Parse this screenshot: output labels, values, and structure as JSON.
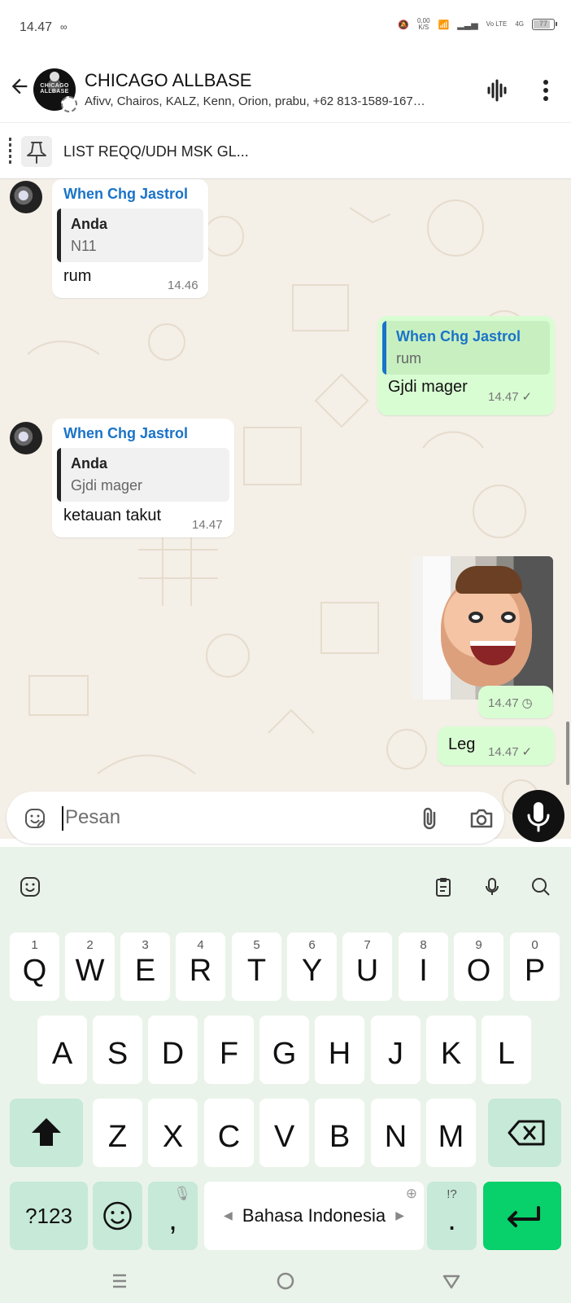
{
  "status_bar": {
    "time": "14.47",
    "speed_value": "0,00",
    "speed_unit": "K/S",
    "volte": "Vo LTE",
    "network": "4G",
    "battery": "77",
    "battery_level": 0.77
  },
  "header": {
    "title": "CHICAGO ALLBASE",
    "subtitle": "Afivv, Chairos, KALZ, Kenn, Orion, prabu, +62 813-1589-167…",
    "avatar_text": "CHICAGO ALLBASE"
  },
  "pinned": {
    "text": "LIST REQQ/UDH MSK GL..."
  },
  "messages": [
    {
      "sender": "When Chg Jastrol",
      "quote_author": "Anda",
      "quote_text": "N11",
      "text": "rum",
      "time": "14.46"
    },
    {
      "quote_author": "When Chg Jastrol",
      "quote_text": "rum",
      "text": "Gjdi mager",
      "time": "14.47"
    },
    {
      "sender": "When Chg Jastrol",
      "quote_author": "Anda",
      "quote_text": "Gjdi mager",
      "text": "ketauan takut",
      "time": "14.47"
    },
    {
      "time": "14.47"
    },
    {
      "text": "Leg",
      "time": "14.47"
    }
  ],
  "input": {
    "placeholder": "Pesan"
  },
  "keyboard": {
    "row1": [
      {
        "key": "Q",
        "num": "1"
      },
      {
        "key": "W",
        "num": "2"
      },
      {
        "key": "E",
        "num": "3"
      },
      {
        "key": "R",
        "num": "4"
      },
      {
        "key": "T",
        "num": "5"
      },
      {
        "key": "Y",
        "num": "6"
      },
      {
        "key": "U",
        "num": "7"
      },
      {
        "key": "I",
        "num": "8"
      },
      {
        "key": "O",
        "num": "9"
      },
      {
        "key": "P",
        "num": "0"
      }
    ],
    "row2": [
      "A",
      "S",
      "D",
      "F",
      "G",
      "H",
      "J",
      "K",
      "L"
    ],
    "row3": [
      "Z",
      "X",
      "C",
      "V",
      "B",
      "N",
      "M"
    ],
    "symbols": "?123",
    "comma": ",",
    "space_label": "Bahasa Indonesia",
    "punct_hint": "!?",
    "period": "."
  },
  "colors": {
    "accent": "#1a73c8",
    "outgoing_bubble": "#d9fdd3",
    "chat_background": "#f4efe7",
    "keyboard_background": "#eaf3ea",
    "enter_key": "#08d06a"
  },
  "icons": {
    "back": "arrow-left-icon",
    "voice": "voice-wave-icon",
    "more": "more-vertical-icon",
    "pin": "pin-icon",
    "sticker": "sticker-icon",
    "attach": "paperclip-icon",
    "camera": "camera-icon",
    "mic": "microphone-icon"
  }
}
